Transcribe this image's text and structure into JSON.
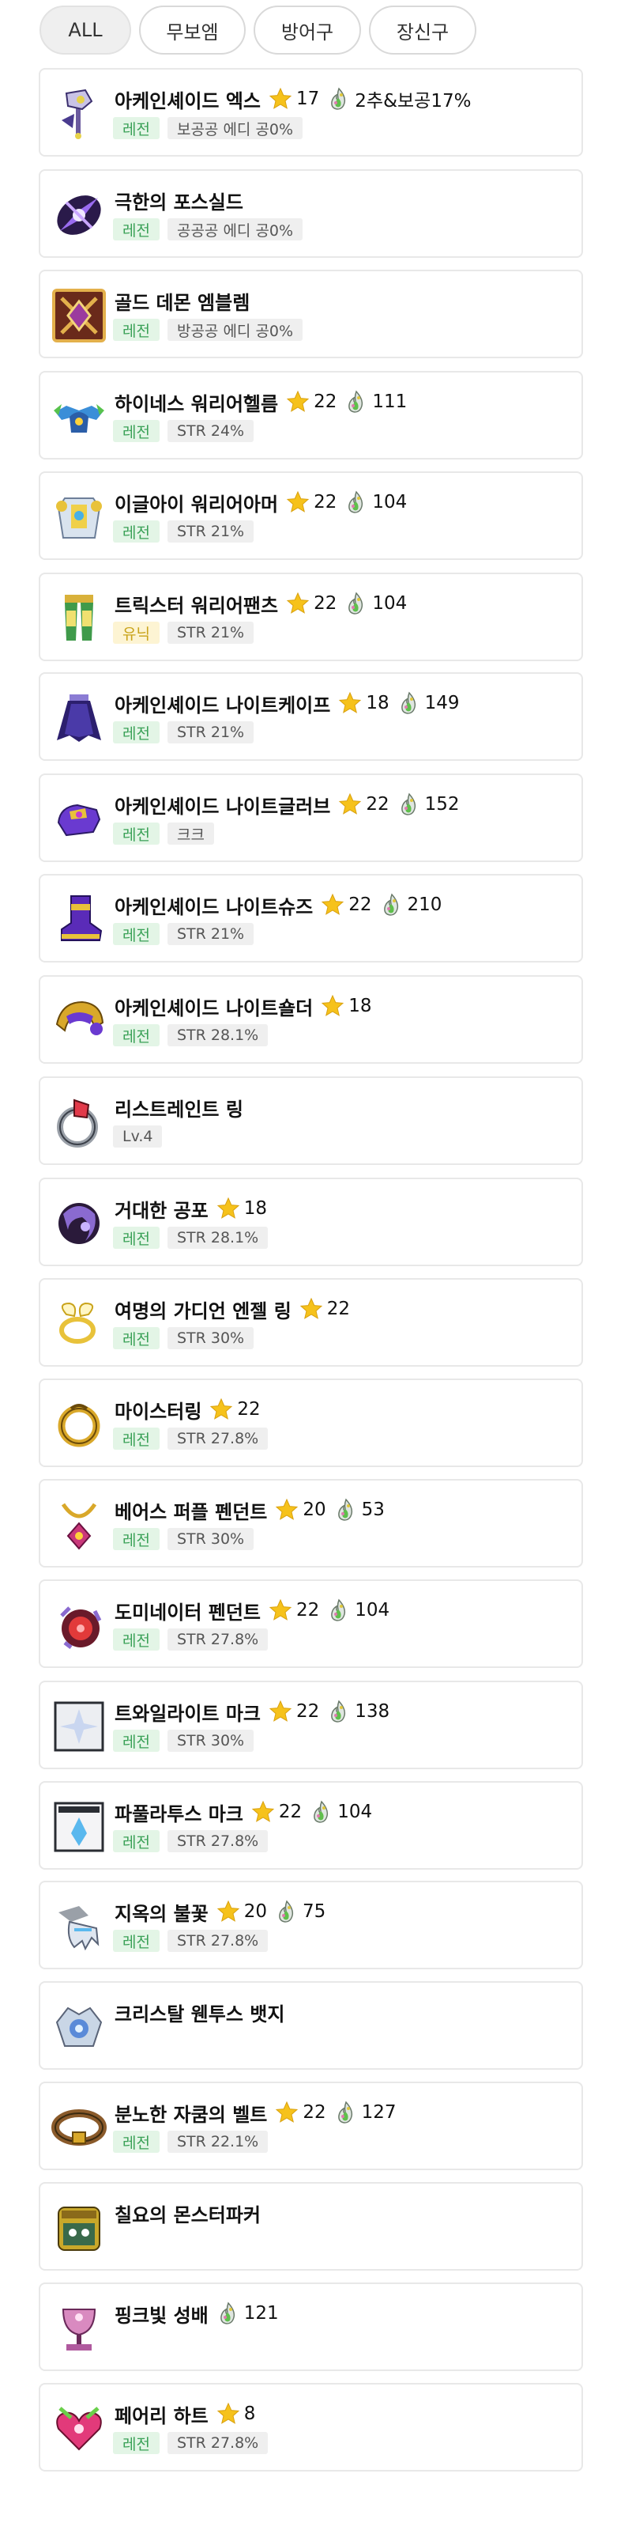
{
  "tabs": [
    {
      "label": "ALL",
      "active": true
    },
    {
      "label": "무보엠",
      "active": false
    },
    {
      "label": "방어구",
      "active": false
    },
    {
      "label": "장신구",
      "active": false
    }
  ],
  "colors": {
    "legend_badge": "#3aa157",
    "unique_badge": "#c9a31a",
    "star": "#f6c21b"
  },
  "items": [
    {
      "name": "아케인셰이드 엑스",
      "star": "17",
      "flame": "2추&보공17%",
      "grade": "레전",
      "grade_type": "legend",
      "option": "보공공 에디 공0%",
      "icon": "arcane-axe-icon"
    },
    {
      "name": "극한의 포스실드",
      "star": null,
      "flame": null,
      "grade": "레전",
      "grade_type": "legend",
      "option": "공공공 에디 공0%",
      "icon": "force-shield-icon"
    },
    {
      "name": "골드 데몬 엠블렘",
      "star": null,
      "flame": null,
      "grade": "레전",
      "grade_type": "legend",
      "option": "방공공 에디 공0%",
      "icon": "demon-emblem-icon"
    },
    {
      "name": "하이네스 워리어헬름",
      "star": "22",
      "flame": "111",
      "grade": "레전",
      "grade_type": "legend",
      "option": "STR 24%",
      "icon": "warrior-helm-icon"
    },
    {
      "name": "이글아이 워리어아머",
      "star": "22",
      "flame": "104",
      "grade": "레전",
      "grade_type": "legend",
      "option": "STR 21%",
      "icon": "warrior-armor-icon"
    },
    {
      "name": "트릭스터 워리어팬츠",
      "star": "22",
      "flame": "104",
      "grade": "유닉",
      "grade_type": "unique",
      "option": "STR 21%",
      "icon": "warrior-pants-icon"
    },
    {
      "name": "아케인셰이드 나이트케이프",
      "star": "18",
      "flame": "149",
      "grade": "레전",
      "grade_type": "legend",
      "option": "STR 21%",
      "icon": "knight-cape-icon"
    },
    {
      "name": "아케인셰이드 나이트글러브",
      "star": "22",
      "flame": "152",
      "grade": "레전",
      "grade_type": "legend",
      "option": "크크",
      "icon": "knight-glove-icon"
    },
    {
      "name": "아케인셰이드 나이트슈즈",
      "star": "22",
      "flame": "210",
      "grade": "레전",
      "grade_type": "legend",
      "option": "STR 21%",
      "icon": "knight-shoes-icon"
    },
    {
      "name": "아케인셰이드 나이트숄더",
      "star": "18",
      "flame": null,
      "grade": "레전",
      "grade_type": "legend",
      "option": "STR 28.1%",
      "icon": "knight-shoulder-icon"
    },
    {
      "name": "리스트레인트 링",
      "star": null,
      "flame": null,
      "grade": null,
      "grade_type": null,
      "option": "Lv.4",
      "icon": "restraint-ring-icon"
    },
    {
      "name": "거대한 공포",
      "star": "18",
      "flame": null,
      "grade": "레전",
      "grade_type": "legend",
      "option": "STR 28.1%",
      "icon": "giant-fear-icon"
    },
    {
      "name": "여명의 가디언 엔젤 링",
      "star": "22",
      "flame": null,
      "grade": "레전",
      "grade_type": "legend",
      "option": "STR 30%",
      "icon": "angel-ring-icon"
    },
    {
      "name": "마이스터링",
      "star": "22",
      "flame": null,
      "grade": "레전",
      "grade_type": "legend",
      "option": "STR 27.8%",
      "icon": "meister-ring-icon"
    },
    {
      "name": "베어스 퍼플 펜던트",
      "star": "20",
      "flame": "53",
      "grade": "레전",
      "grade_type": "legend",
      "option": "STR 30%",
      "icon": "purple-pendant-icon"
    },
    {
      "name": "도미네이터 펜던트",
      "star": "22",
      "flame": "104",
      "grade": "레전",
      "grade_type": "legend",
      "option": "STR 27.8%",
      "icon": "dominator-pendant-icon"
    },
    {
      "name": "트와일라이트 마크",
      "star": "22",
      "flame": "138",
      "grade": "레전",
      "grade_type": "legend",
      "option": "STR 30%",
      "icon": "twilight-mark-icon"
    },
    {
      "name": "파풀라투스 마크",
      "star": "22",
      "flame": "104",
      "grade": "레전",
      "grade_type": "legend",
      "option": "STR 27.8%",
      "icon": "papulatus-mark-icon"
    },
    {
      "name": "지옥의 불꽃",
      "star": "20",
      "flame": "75",
      "grade": "레전",
      "grade_type": "legend",
      "option": "STR 27.8%",
      "icon": "hell-flame-icon"
    },
    {
      "name": "크리스탈 웬투스 뱃지",
      "star": null,
      "flame": null,
      "grade": null,
      "grade_type": null,
      "option": null,
      "icon": "crystal-badge-icon"
    },
    {
      "name": "분노한 자쿰의 벨트",
      "star": "22",
      "flame": "127",
      "grade": "레전",
      "grade_type": "legend",
      "option": "STR 22.1%",
      "icon": "zakum-belt-icon"
    },
    {
      "name": "칠요의 몬스터파커",
      "star": null,
      "flame": null,
      "grade": null,
      "grade_type": null,
      "option": null,
      "icon": "monster-parker-icon"
    },
    {
      "name": "핑크빛 성배",
      "star": null,
      "flame": "121",
      "grade": null,
      "grade_type": null,
      "option": null,
      "icon": "pink-grail-icon"
    },
    {
      "name": "페어리 하트",
      "star": "8",
      "flame": null,
      "grade": "레전",
      "grade_type": "legend",
      "option": "STR 27.8%",
      "icon": "fairy-heart-icon"
    }
  ]
}
